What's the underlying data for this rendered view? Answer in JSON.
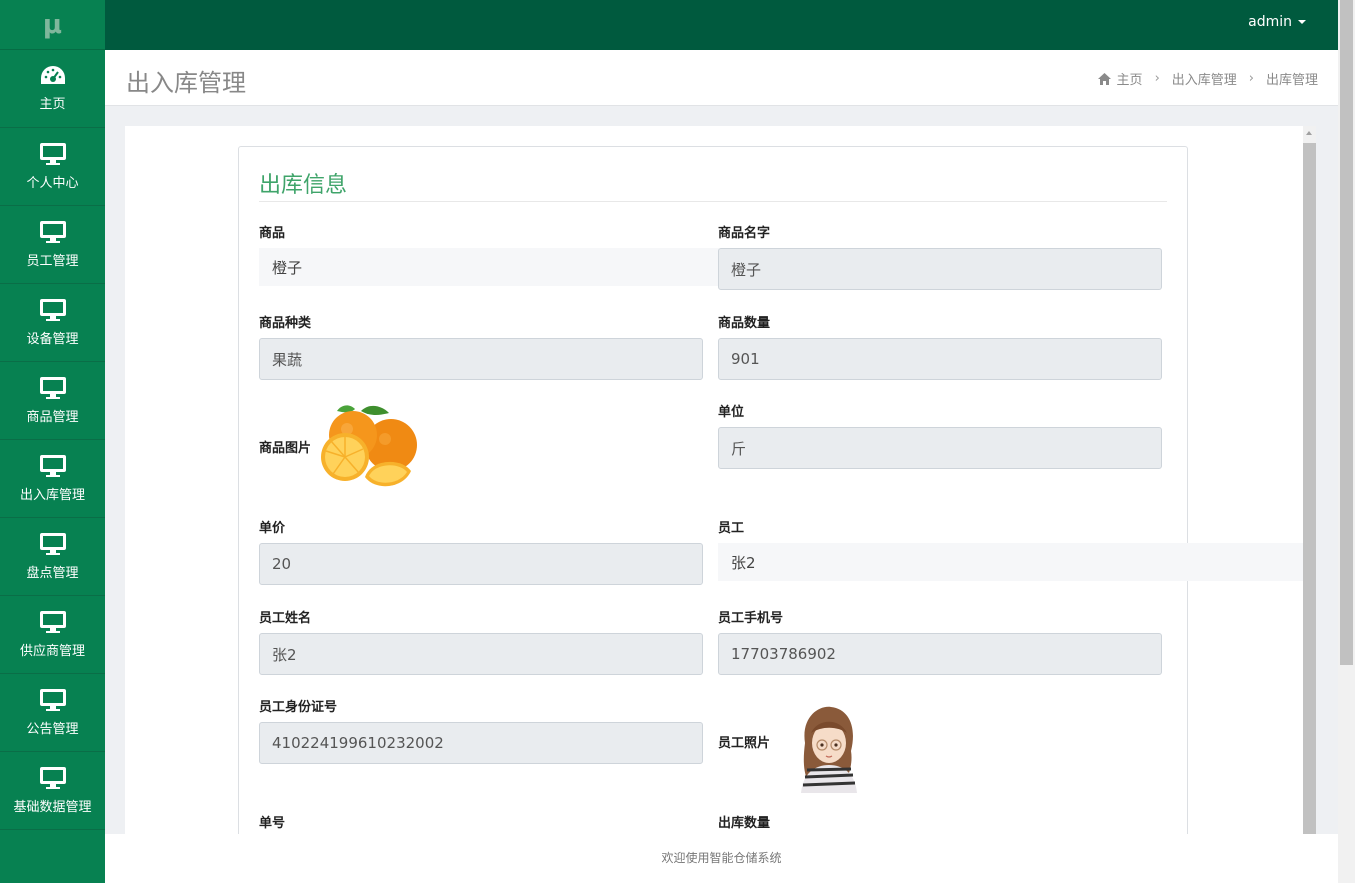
{
  "sidebar": {
    "logo": "μ",
    "items": [
      {
        "label": "主页",
        "icon": "dashboard-icon"
      },
      {
        "label": "个人中心",
        "icon": "monitor-icon"
      },
      {
        "label": "员工管理",
        "icon": "monitor-icon"
      },
      {
        "label": "设备管理",
        "icon": "monitor-icon"
      },
      {
        "label": "商品管理",
        "icon": "monitor-icon"
      },
      {
        "label": "出入库管理",
        "icon": "monitor-icon"
      },
      {
        "label": "盘点管理",
        "icon": "monitor-icon"
      },
      {
        "label": "供应商管理",
        "icon": "monitor-icon"
      },
      {
        "label": "公告管理",
        "icon": "monitor-icon"
      },
      {
        "label": "基础数据管理",
        "icon": "monitor-icon"
      }
    ]
  },
  "topbar": {
    "user": "admin"
  },
  "header": {
    "title": "出入库管理",
    "breadcrumb": [
      "主页",
      "出入库管理",
      "出库管理"
    ]
  },
  "form": {
    "title": "出库信息",
    "goods": {
      "label": "商品",
      "value": "橙子"
    },
    "goods_name": {
      "label": "商品名字",
      "value": "橙子"
    },
    "goods_type": {
      "label": "商品种类",
      "value": "果蔬"
    },
    "goods_qty": {
      "label": "商品数量",
      "value": "901"
    },
    "goods_image": {
      "label": "商品图片"
    },
    "unit": {
      "label": "单位",
      "value": "斤"
    },
    "price": {
      "label": "单价",
      "value": "20"
    },
    "staff": {
      "label": "员工",
      "value": "张2"
    },
    "staff_name": {
      "label": "员工姓名",
      "value": "张2"
    },
    "staff_phone": {
      "label": "员工手机号",
      "value": "17703786902"
    },
    "staff_id": {
      "label": "员工身份证号",
      "value": "410224199610232002"
    },
    "staff_photo": {
      "label": "员工照片"
    },
    "order_no": {
      "label": "单号"
    },
    "out_qty": {
      "label": "出库数量"
    }
  },
  "footer": {
    "text": "欢迎使用智能仓储系统"
  },
  "colors": {
    "sidebar": "#078151",
    "topbar": "#005a3e",
    "accent": "#3fa46a"
  }
}
